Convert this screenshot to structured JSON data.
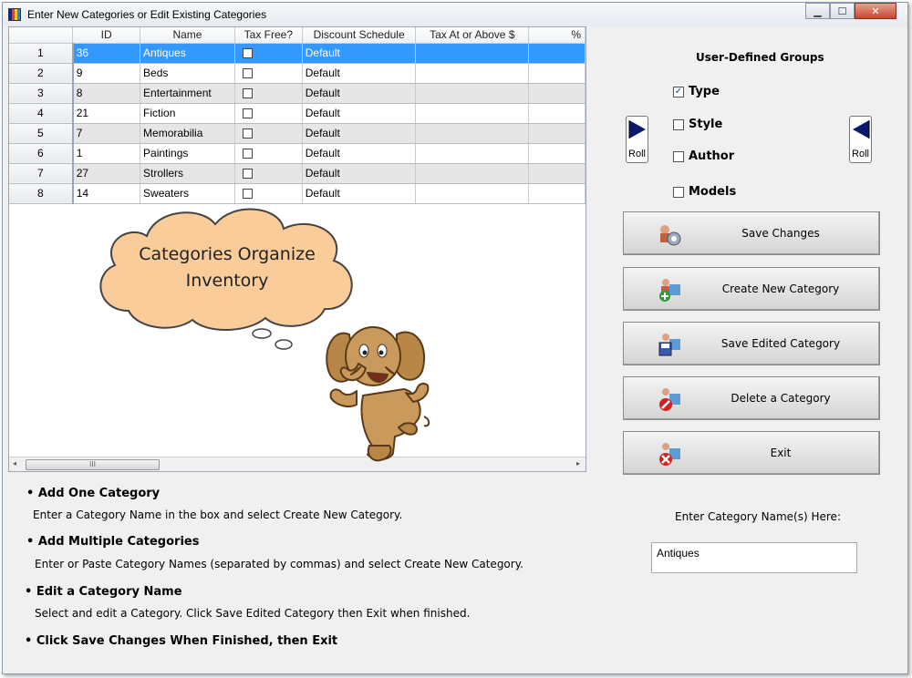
{
  "window": {
    "title": "Enter New Categories or Edit Existing Categories",
    "min": "▁",
    "max": "☐",
    "close": "✕"
  },
  "grid": {
    "columns": [
      "",
      "ID",
      "Name",
      "Tax Free?",
      "Discount Schedule",
      "Tax At or Above $",
      "%"
    ],
    "rows": [
      {
        "num": "1",
        "id": "36",
        "name": "Antiques",
        "schedule": "Default"
      },
      {
        "num": "2",
        "id": "9",
        "name": "Beds",
        "schedule": "Default"
      },
      {
        "num": "3",
        "id": "8",
        "name": "Entertainment",
        "schedule": "Default"
      },
      {
        "num": "4",
        "id": "21",
        "name": "Fiction",
        "schedule": "Default"
      },
      {
        "num": "5",
        "id": "7",
        "name": "Memorabilia",
        "schedule": "Default"
      },
      {
        "num": "6",
        "id": "1",
        "name": "Paintings",
        "schedule": "Default"
      },
      {
        "num": "7",
        "id": "27",
        "name": "Strollers",
        "schedule": "Default"
      },
      {
        "num": "8",
        "id": "14",
        "name": "Sweaters",
        "schedule": "Default"
      }
    ],
    "scroll_grip": "III"
  },
  "cloud": {
    "line1": "Categories Organize",
    "line2": "Inventory"
  },
  "groups": {
    "title": "User-Defined  Groups",
    "items": [
      {
        "label": "Type",
        "checked": true
      },
      {
        "label": "Style",
        "checked": false
      },
      {
        "label": "Author",
        "checked": false
      },
      {
        "label": "Models",
        "checked": false
      }
    ],
    "roll_label": "Roll"
  },
  "actions": {
    "save_changes": "Save Changes",
    "create_new": "Create New Category",
    "save_edited": "Save Edited Category",
    "delete": "Delete a Category",
    "exit": "Exit"
  },
  "instructions": {
    "h1": "• Add One Category",
    "b1": "Enter a Category Name in the box and select Create New Category.",
    "h2": "• Add Multiple Categories",
    "b2": "Enter or Paste Category Names (separated by commas) and select Create New Category.",
    "h3": "• Edit a Category Name",
    "b3": "Select and edit a Category. Click Save Edited Category then Exit when finished.",
    "h4": "• Click Save Changes When Finished, then Exit"
  },
  "entry": {
    "label": "Enter Category Name(s) Here:",
    "value": "Antiques"
  },
  "colors": {
    "selection": "#3399ff",
    "cloud_fill": "#f9cc99"
  }
}
